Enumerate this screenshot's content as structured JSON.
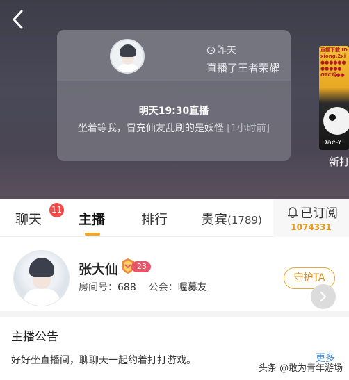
{
  "hero": {
    "card": {
      "time": "昨天",
      "subtitle": "直播了王者荣耀",
      "schedule": "明天19:30直播",
      "message": "坐着等我，冒充仙友乱刷的是妖怪",
      "ago": "[1小时前]"
    },
    "peek": {
      "label": "新打",
      "overlay_text": "Dae-Y",
      "top_text": "直播下载 ID\nxiong.2xi\n●●●●●●\n●●●●●\nGTC鸡●●"
    }
  },
  "tabs": {
    "chat": "聊天",
    "chat_badge": "11",
    "host": "主播",
    "rank": "排行",
    "vip": "贵宾",
    "vip_count": "(1789)",
    "active": "host"
  },
  "subscribe": {
    "label": "已订阅",
    "count": "1074331"
  },
  "profile": {
    "name": "张大仙",
    "level": "23",
    "room_label": "房间号：",
    "room_no": "688",
    "guild_label": "公会：",
    "guild": "喔募友",
    "guard_label": "守护TA"
  },
  "notice": {
    "title": "主播公告",
    "body": "好好坐直播间，聊聊天一起约着打打游戏。",
    "more": "更多"
  },
  "watermark": "头条 @敢为青年游场",
  "colors": {
    "accent": "#f5a623",
    "badge": "#f04b4b",
    "level": "#e9566a",
    "link": "#4a8fd8"
  }
}
